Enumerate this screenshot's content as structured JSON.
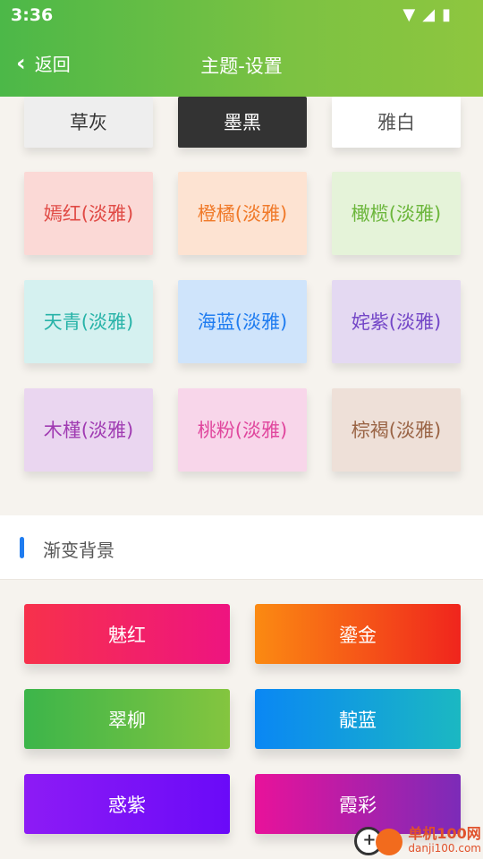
{
  "status": {
    "time": "3:36",
    "wifi_icon": "▼",
    "signal_icon": "◢",
    "battery_icon": "▮"
  },
  "header": {
    "back_label": "返回",
    "title": "主题-设置"
  },
  "themes": [
    {
      "label": "草灰",
      "bg": "#eeeeee",
      "fg": "#333333"
    },
    {
      "label": "墨黑",
      "bg": "#333333",
      "fg": "#ffffff"
    },
    {
      "label": "雅白",
      "bg": "#ffffff",
      "fg": "#555555"
    },
    {
      "label": "嫣红(淡雅)",
      "bg": "#fbd9d6",
      "fg": "#e04a45"
    },
    {
      "label": "橙橘(淡雅)",
      "bg": "#fde3d2",
      "fg": "#f07a2a"
    },
    {
      "label": "橄榄(淡雅)",
      "bg": "#e5f3d9",
      "fg": "#6cb63c"
    },
    {
      "label": "天青(淡雅)",
      "bg": "#d5f1f0",
      "fg": "#27b3a8"
    },
    {
      "label": "海蓝(淡雅)",
      "bg": "#cfe4fb",
      "fg": "#1f7cf0"
    },
    {
      "label": "姹紫(淡雅)",
      "bg": "#e4d9f2",
      "fg": "#7346c7"
    },
    {
      "label": "木槿(淡雅)",
      "bg": "#ead6f0",
      "fg": "#a03bb2"
    },
    {
      "label": "桃粉(淡雅)",
      "bg": "#f8d6ea",
      "fg": "#e0469d"
    },
    {
      "label": "棕褐(淡雅)",
      "bg": "#eee0d8",
      "fg": "#9a6445"
    }
  ],
  "section": {
    "label": "渐变背景"
  },
  "gradients": [
    {
      "label": "魅红",
      "from": "#f7314b",
      "to": "#ee1480"
    },
    {
      "label": "鎏金",
      "from": "#fb8a12",
      "to": "#f0251d"
    },
    {
      "label": "翠柳",
      "from": "#3cb54a",
      "to": "#84c53f"
    },
    {
      "label": "靛蓝",
      "from": "#0a87f4",
      "to": "#1bb8c2"
    },
    {
      "label": "惑紫",
      "from": "#8d1bf5",
      "to": "#6a0af8"
    },
    {
      "label": "霞彩",
      "from": "#e8129a",
      "to": "#7c2bb8"
    }
  ],
  "watermark": {
    "line1": "单机100网",
    "line2": "danji100.com"
  }
}
